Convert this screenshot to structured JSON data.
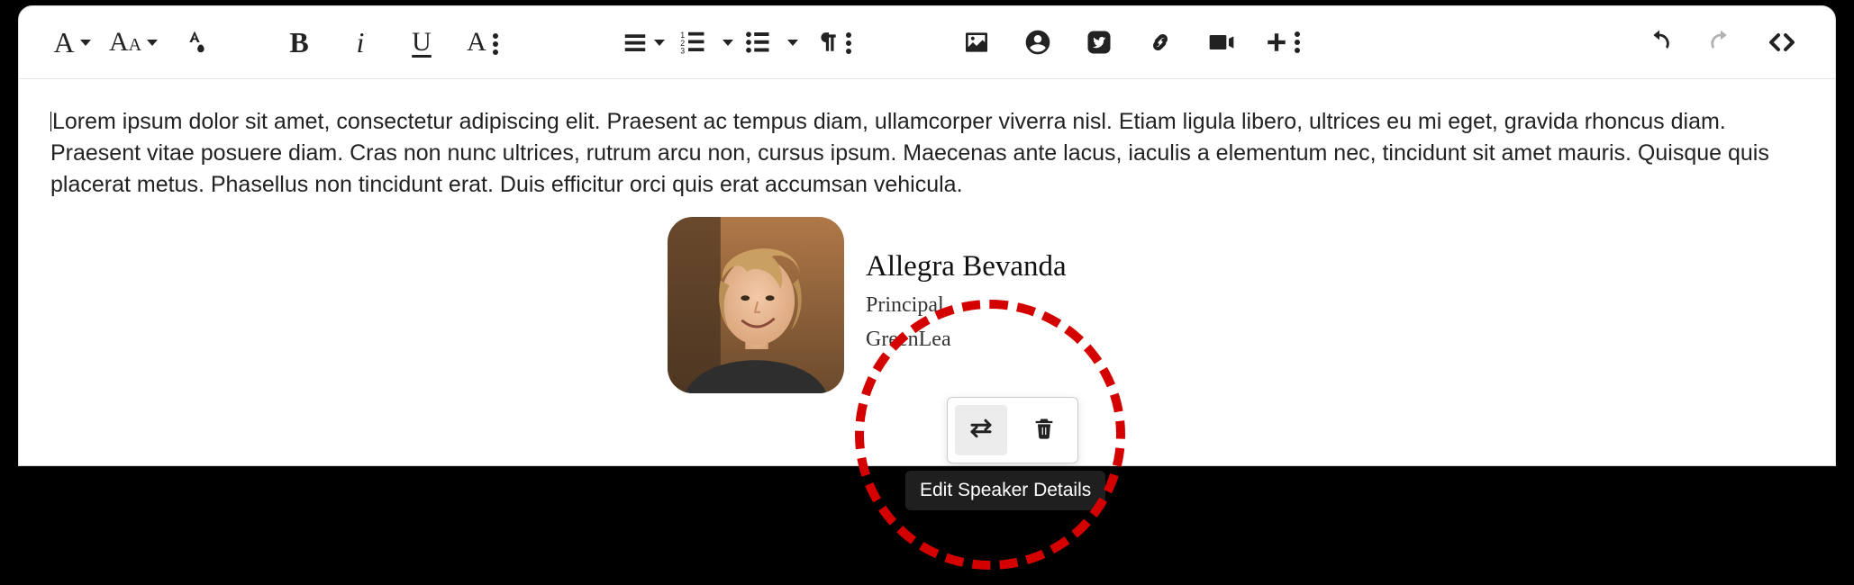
{
  "content": {
    "paragraph": "Lorem ipsum dolor sit amet, consectetur adipiscing elit. Praesent ac tempus diam, ullamcorper viverra nisl. Etiam ligula libero, ultrices eu mi eget, gravida rhoncus diam. Praesent vitae posuere diam. Cras non nunc ultrices, rutrum arcu non, cursus ipsum. Maecenas ante lacus, iaculis a elementum nec, tincidunt sit amet mauris. Quisque quis placerat metus. Phasellus non tincidunt erat. Duis efficitur orci quis erat accumsan vehicula."
  },
  "speaker": {
    "name": "Allegra Bevanda",
    "role": "Principal",
    "organization_visible": "GreenLea"
  },
  "tooltip": {
    "edit_speaker": "Edit Speaker Details"
  },
  "toolbar": {
    "font_family_glyph": "A",
    "font_size_glyph": "Aᴀ",
    "bold_glyph": "B",
    "italic_glyph": "i",
    "underline_glyph": "U"
  }
}
